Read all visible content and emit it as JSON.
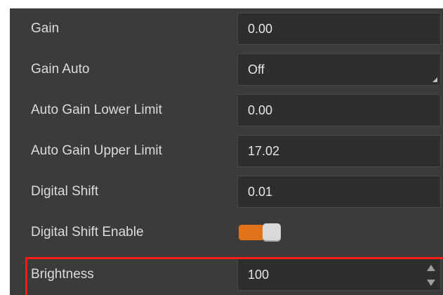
{
  "properties": [
    {
      "label": "Gain",
      "value": "0.00",
      "control": "text"
    },
    {
      "label": "Gain Auto",
      "value": "Off",
      "control": "dropdown"
    },
    {
      "label": "Auto Gain Lower Limit",
      "value": "0.00",
      "control": "text"
    },
    {
      "label": "Auto Gain Upper Limit",
      "value": "17.02",
      "control": "text"
    },
    {
      "label": "Digital Shift",
      "value": "0.01",
      "control": "text"
    },
    {
      "label": "Digital Shift Enable",
      "value": true,
      "control": "toggle"
    },
    {
      "label": "Brightness",
      "value": "100",
      "control": "number"
    }
  ],
  "colors": {
    "panel_bg": "#3b3b3b",
    "field_bg": "#2e2e2e",
    "text": "#dcdcdc",
    "toggle_on": "#e07218",
    "highlight": "#ff1a1a"
  },
  "icons": {
    "dropdown": "dropdown-corner-icon",
    "stepper_up": "chevron-up-icon",
    "stepper_down": "chevron-down-icon"
  }
}
